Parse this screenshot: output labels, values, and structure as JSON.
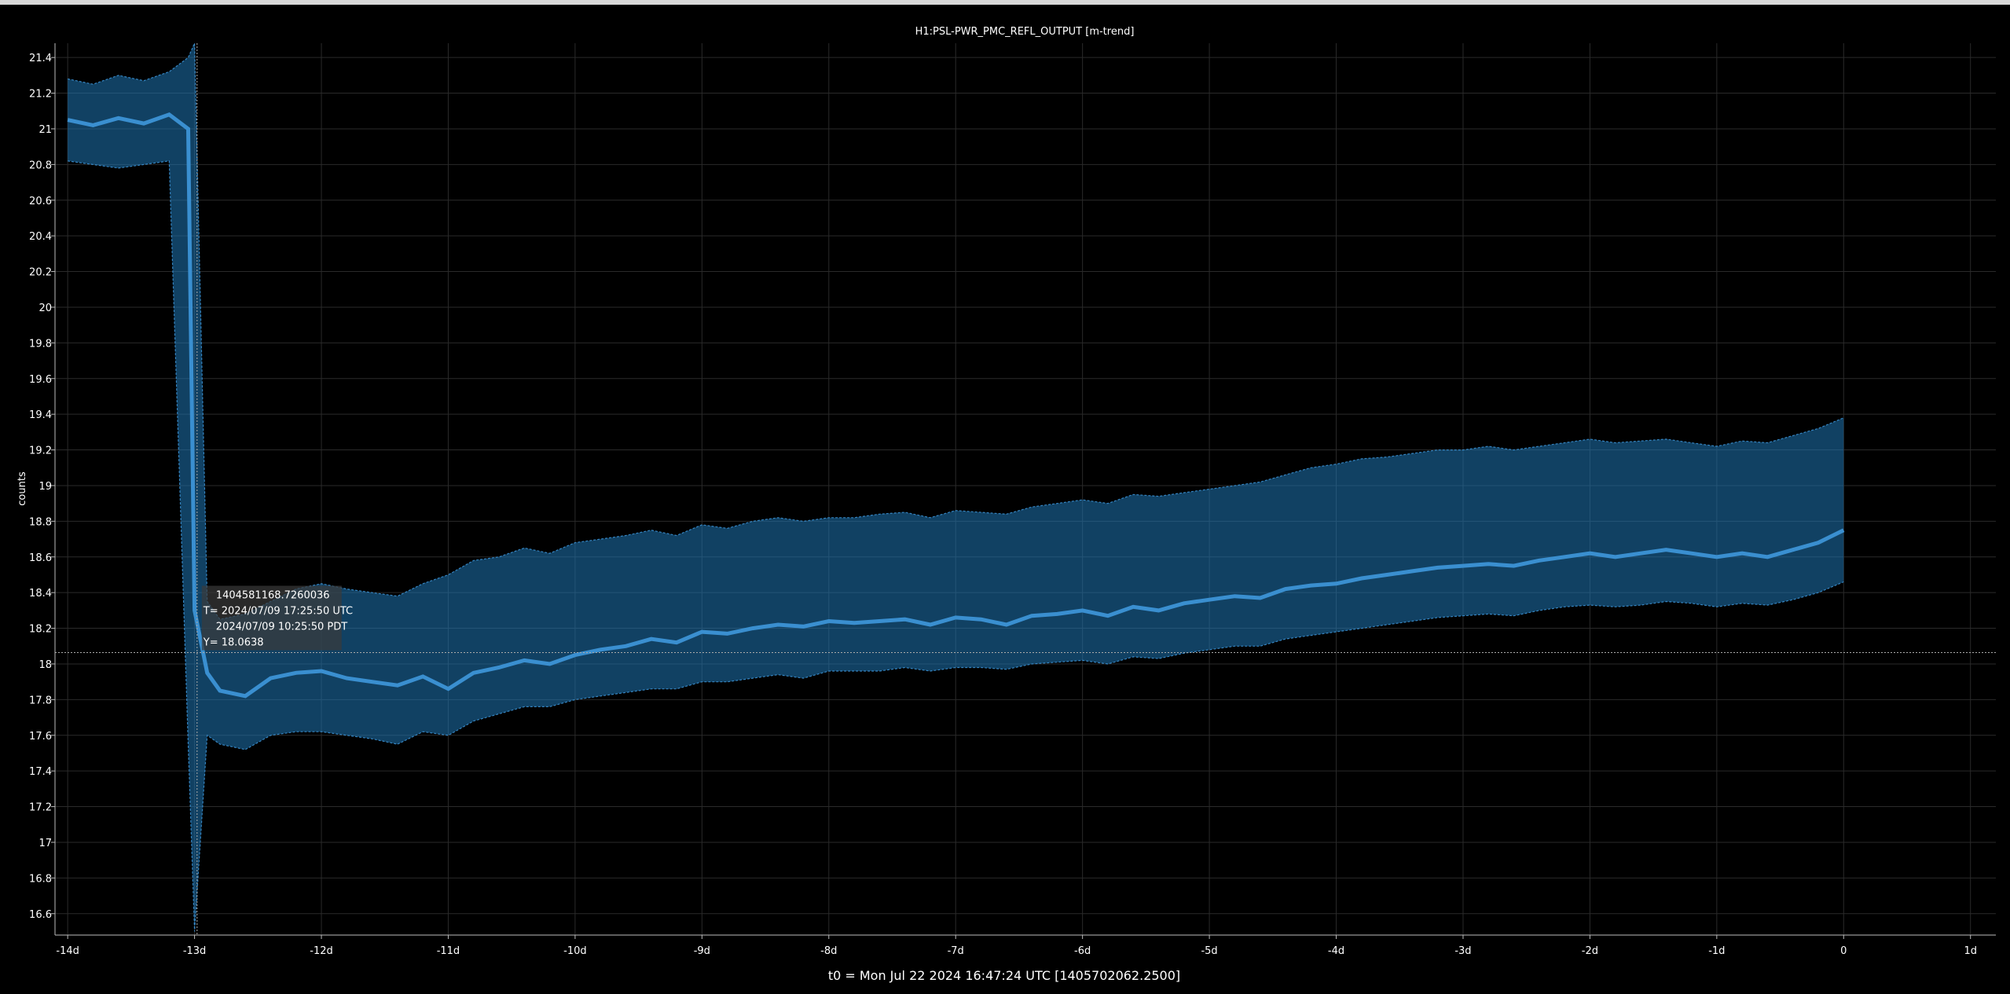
{
  "window": {
    "title": "H1:PSL-PWR_PMC_REFL_OUTPUT [m-trend]"
  },
  "colors": {
    "background": "#000000",
    "trace": "#1f77b4",
    "trace_light": "#3a8fd0",
    "grid": "#2a2a2a",
    "axis": "#ffffff",
    "text": "#ffffff",
    "tooltip_bg": "#3a3a3a"
  },
  "chart_data": {
    "type": "line",
    "title": "H1:PSL-PWR_PMC_REFL_OUTPUT [m-trend]",
    "xlabel": "t0 = Mon Jul 22 2024 16:47:24 UTC [1405702062.2500]",
    "ylabel": "counts",
    "x_unit": "days relative to t0",
    "xlim": [
      -14.1,
      1.2
    ],
    "ylim": [
      16.48,
      21.48
    ],
    "grid": true,
    "x_ticks": [
      -14,
      -13,
      -12,
      -11,
      -10,
      -9,
      -8,
      -7,
      -6,
      -5,
      -4,
      -3,
      -2,
      -1,
      0,
      1
    ],
    "x_tick_labels": [
      "-14d",
      "-13d",
      "-12d",
      "-11d",
      "-10d",
      "-9d",
      "-8d",
      "-7d",
      "-6d",
      "-5d",
      "-4d",
      "-3d",
      "-2d",
      "-1d",
      "0",
      "1d"
    ],
    "y_ticks": [
      16.6,
      16.8,
      17,
      17.2,
      17.4,
      17.6,
      17.8,
      18,
      18.2,
      18.4,
      18.6,
      18.8,
      19,
      19.2,
      19.4,
      19.6,
      19.8,
      20,
      20.2,
      20.4,
      20.6,
      20.8,
      21,
      21.2,
      21.4
    ],
    "y_tick_labels": [
      "16.6",
      "16.8",
      "17",
      "17.2",
      "17.4",
      "17.6",
      "17.8",
      "18",
      "18.2",
      "18.4",
      "18.6",
      "18.8",
      "19",
      "19.2",
      "19.4",
      "19.6",
      "19.8",
      "20",
      "20.2",
      "20.4",
      "20.6",
      "20.8",
      "21",
      "21.2",
      "21.4"
    ],
    "series": [
      {
        "x": [
          -14.0,
          -13.8,
          -13.6,
          -13.4,
          -13.2,
          -13.05,
          -13.0,
          -12.9,
          -12.8,
          -12.6,
          -12.4,
          -12.2,
          -12.0,
          -11.8,
          -11.6,
          -11.4,
          -11.2,
          -11.0,
          -10.8,
          -10.6,
          -10.4,
          -10.2,
          -10.0,
          -9.8,
          -9.6,
          -9.4,
          -9.2,
          -9.0,
          -8.8,
          -8.6,
          -8.4,
          -8.2,
          -8.0,
          -7.8,
          -7.6,
          -7.4,
          -7.2,
          -7.0,
          -6.8,
          -6.6,
          -6.4,
          -6.2,
          -6.0,
          -5.8,
          -5.6,
          -5.4,
          -5.2,
          -5.0,
          -4.8,
          -4.6,
          -4.4,
          -4.2,
          -4.0,
          -3.8,
          -3.6,
          -3.4,
          -3.2,
          -3.0,
          -2.8,
          -2.6,
          -2.4,
          -2.2,
          -2.0,
          -1.8,
          -1.6,
          -1.4,
          -1.2,
          -1.0,
          -0.8,
          -0.6,
          -0.4,
          -0.2,
          0.0
        ],
        "y_mean": [
          21.05,
          21.02,
          21.06,
          21.03,
          21.08,
          21.0,
          18.3,
          17.95,
          17.85,
          17.82,
          17.92,
          17.95,
          17.96,
          17.92,
          17.9,
          17.88,
          17.93,
          17.86,
          17.95,
          17.98,
          18.02,
          18.0,
          18.05,
          18.08,
          18.1,
          18.14,
          18.12,
          18.18,
          18.17,
          18.2,
          18.22,
          18.21,
          18.24,
          18.23,
          18.24,
          18.25,
          18.22,
          18.26,
          18.25,
          18.22,
          18.27,
          18.28,
          18.3,
          18.27,
          18.32,
          18.3,
          18.34,
          18.36,
          18.38,
          18.37,
          18.42,
          18.44,
          18.45,
          18.48,
          18.5,
          18.52,
          18.54,
          18.55,
          18.56,
          18.55,
          18.58,
          18.6,
          18.62,
          18.6,
          18.62,
          18.64,
          18.62,
          18.6,
          18.62,
          18.6,
          18.64,
          18.68,
          18.75
        ],
        "y_max": [
          21.28,
          21.25,
          21.3,
          21.27,
          21.32,
          21.4,
          21.48,
          18.35,
          18.25,
          18.28,
          18.35,
          18.42,
          18.45,
          18.42,
          18.4,
          18.38,
          18.45,
          18.5,
          18.58,
          18.6,
          18.65,
          18.62,
          18.68,
          18.7,
          18.72,
          18.75,
          18.72,
          18.78,
          18.76,
          18.8,
          18.82,
          18.8,
          18.82,
          18.82,
          18.84,
          18.85,
          18.82,
          18.86,
          18.85,
          18.84,
          18.88,
          18.9,
          18.92,
          18.9,
          18.95,
          18.94,
          18.96,
          18.98,
          19.0,
          19.02,
          19.06,
          19.1,
          19.12,
          19.15,
          19.16,
          19.18,
          19.2,
          19.2,
          19.22,
          19.2,
          19.22,
          19.24,
          19.26,
          19.24,
          19.25,
          19.26,
          19.24,
          19.22,
          19.25,
          19.24,
          19.28,
          19.32,
          19.38
        ],
        "y_min": [
          20.82,
          20.8,
          20.78,
          20.8,
          20.82,
          17.55,
          16.5,
          17.6,
          17.55,
          17.52,
          17.6,
          17.62,
          17.62,
          17.6,
          17.58,
          17.55,
          17.62,
          17.6,
          17.68,
          17.72,
          17.76,
          17.76,
          17.8,
          17.82,
          17.84,
          17.86,
          17.86,
          17.9,
          17.9,
          17.92,
          17.94,
          17.92,
          17.96,
          17.96,
          17.96,
          17.98,
          17.96,
          17.98,
          17.98,
          17.97,
          18.0,
          18.01,
          18.02,
          18.0,
          18.04,
          18.03,
          18.06,
          18.08,
          18.1,
          18.1,
          18.14,
          18.16,
          18.18,
          18.2,
          18.22,
          18.24,
          18.26,
          18.27,
          18.28,
          18.27,
          18.3,
          18.32,
          18.33,
          18.32,
          18.33,
          18.35,
          18.34,
          18.32,
          18.34,
          18.33,
          18.36,
          18.4,
          18.46
        ]
      }
    ]
  },
  "cursor": {
    "x": -12.98,
    "y": 18.0638,
    "gps": "1404581168.7260036",
    "utc": "T= 2024/07/09 17:25:50 UTC",
    "pdt": "2024/07/09 10:25:50 PDT",
    "y_text": "Y= 18.0638"
  }
}
